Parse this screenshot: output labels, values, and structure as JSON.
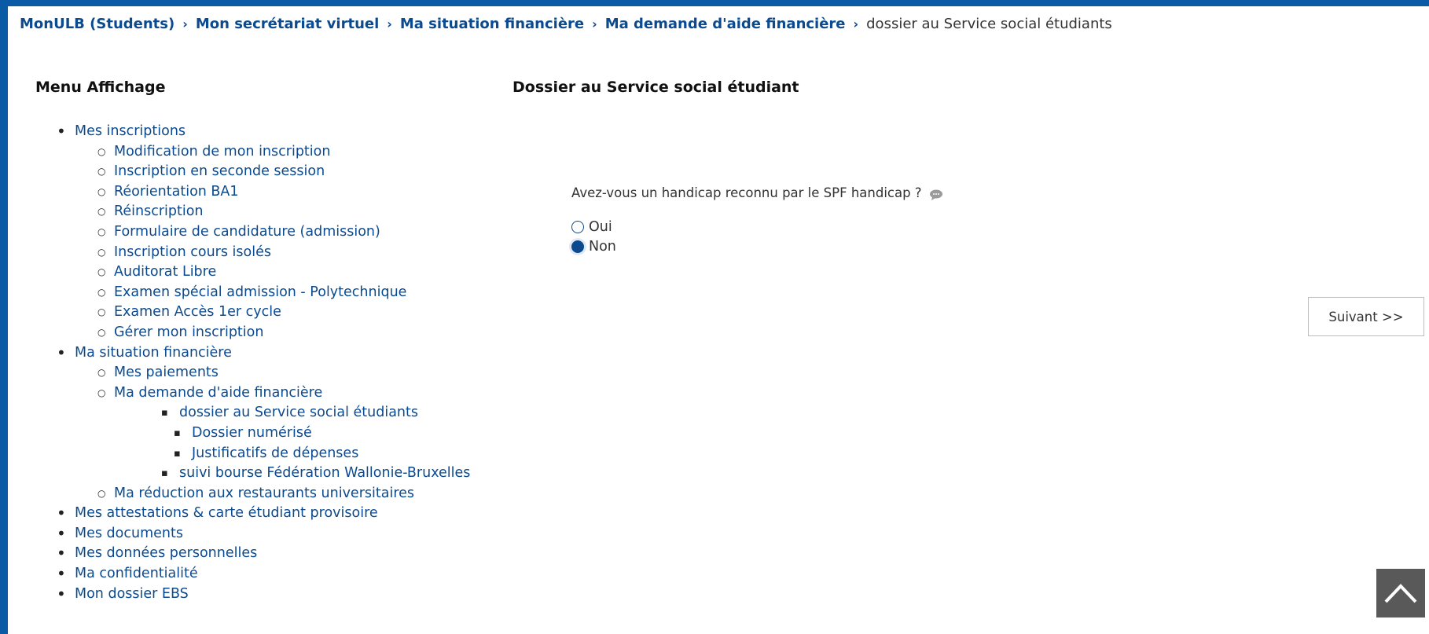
{
  "breadcrumb": {
    "items": [
      "MonULB (Students)",
      "Mon secrétariat virtuel",
      "Ma situation financière",
      "Ma demande d'aide financière"
    ],
    "separator": "›",
    "current": "dossier au Service social étudiants"
  },
  "menu": {
    "title": "Menu Affichage",
    "items": [
      {
        "label": "Mes inscriptions",
        "level": 1
      },
      {
        "label": "Modification de mon inscription",
        "level": 2
      },
      {
        "label": "Inscription en seconde session",
        "level": 2
      },
      {
        "label": "Réorientation BA1",
        "level": 2
      },
      {
        "label": "Réinscription",
        "level": 2
      },
      {
        "label": "Formulaire de candidature (admission)",
        "level": 2
      },
      {
        "label": "Inscription cours isolés",
        "level": 2
      },
      {
        "label": "Auditorat Libre",
        "level": 2
      },
      {
        "label": "Examen spécial admission - Polytechnique",
        "level": 2
      },
      {
        "label": "Examen Accès 1er cycle",
        "level": 2
      },
      {
        "label": "Gérer mon inscription",
        "level": 2
      },
      {
        "label": "Ma situation financière",
        "level": 1
      },
      {
        "label": "Mes paiements",
        "level": 2
      },
      {
        "label": "Ma demande d'aide financière",
        "level": 2
      },
      {
        "label": "dossier au Service social étudiants",
        "level": 3
      },
      {
        "label": "Dossier numérisé",
        "level": 4
      },
      {
        "label": "Justificatifs de dépenses",
        "level": 4
      },
      {
        "label": "suivi bourse Fédération Wallonie-Bruxelles",
        "level": 3
      },
      {
        "label": "Ma réduction aux restaurants universitaires",
        "level": 2
      },
      {
        "label": "Mes attestations & carte étudiant provisoire",
        "level": 1
      },
      {
        "label": "Mes documents",
        "level": 1
      },
      {
        "label": "Mes données personnelles",
        "level": 1
      },
      {
        "label": "Ma confidentialité",
        "level": 1
      },
      {
        "label": "Mon dossier EBS",
        "level": 1
      }
    ]
  },
  "main": {
    "title": "Dossier au Service social étudiant",
    "question": "Avez-vous un handicap reconnu par le SPF handicap ?",
    "help_icon": "speech-bubble-icon",
    "options": [
      {
        "label": "Oui",
        "checked": false
      },
      {
        "label": "Non",
        "checked": true
      }
    ],
    "next_button": "Suivant >>"
  },
  "scroll_top_icon": "chevron-up-icon",
  "colors": {
    "accent": "#0a5aa6",
    "link": "#0b4a8f",
    "scroll_button": "#595959"
  }
}
